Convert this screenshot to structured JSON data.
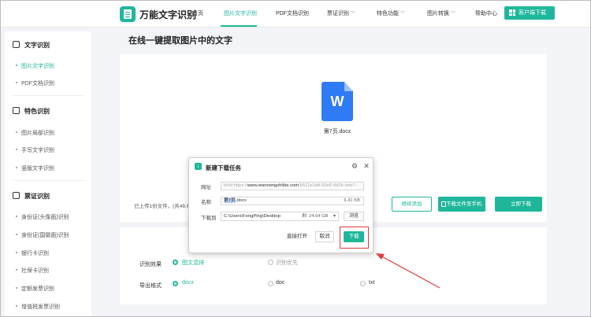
{
  "header": {
    "brand": "万能文字识别",
    "nav": [
      {
        "label": "首页"
      },
      {
        "label": "图片文字识别"
      },
      {
        "label": "PDF文档识别"
      },
      {
        "label": "票证识别"
      },
      {
        "label": "特色功能"
      },
      {
        "label": "图片转换"
      },
      {
        "label": "帮助中心"
      }
    ],
    "client_button": "客户端下载"
  },
  "sidebar": {
    "groups": [
      {
        "title": "文字识别",
        "items": [
          "图片文字识别",
          "PDF文档识别"
        ]
      },
      {
        "title": "特色识别",
        "items": [
          "图片局部识别",
          "手写文字识别",
          "竖版文字识别"
        ]
      },
      {
        "title": "票证识别",
        "items": [
          "身份证(头像面)识别",
          "身份证(国徽面)识别",
          "银行卡识别",
          "社保卡识别",
          "定额发票识别",
          "增值税发票识别"
        ]
      }
    ]
  },
  "main": {
    "title": "在线一键提取图片中的文字",
    "file_name": "第7页.docx",
    "uploaded_note": "已上传1份文件，(共48.6",
    "buttons": {
      "continue": "继续添加",
      "to_phone": "下载文件至手机",
      "download_now": "立即下载"
    },
    "options": {
      "effect_label": "识别效果",
      "effect_options": [
        "图文混排",
        "识别优先"
      ],
      "format_label": "导出格式",
      "format_options": [
        "docx",
        "doc",
        "txt"
      ]
    }
  },
  "dialog": {
    "title": "新建下载任务",
    "url_label": "网址",
    "url_prefix": "blob:https://",
    "url_domain": "www.wannengshibie.com",
    "url_rest": "/b511e2dd-50e8-4d2b-beb7-",
    "name_label": "名称",
    "name_selected": "第7页",
    "name_ext": ".docx",
    "name_size": "6.41 KB",
    "save_label": "下载到",
    "save_path": "C:\\Users\\FengPing\\Desktop",
    "free_space": "剩: 24.64 GB",
    "browse": "浏览",
    "open_direct": "直接打开",
    "cancel": "取消",
    "download": "下载"
  },
  "colors": {
    "accent": "#1fb79b",
    "word_blue": "#2f7bf5",
    "annotation_red": "#e23b3b"
  }
}
